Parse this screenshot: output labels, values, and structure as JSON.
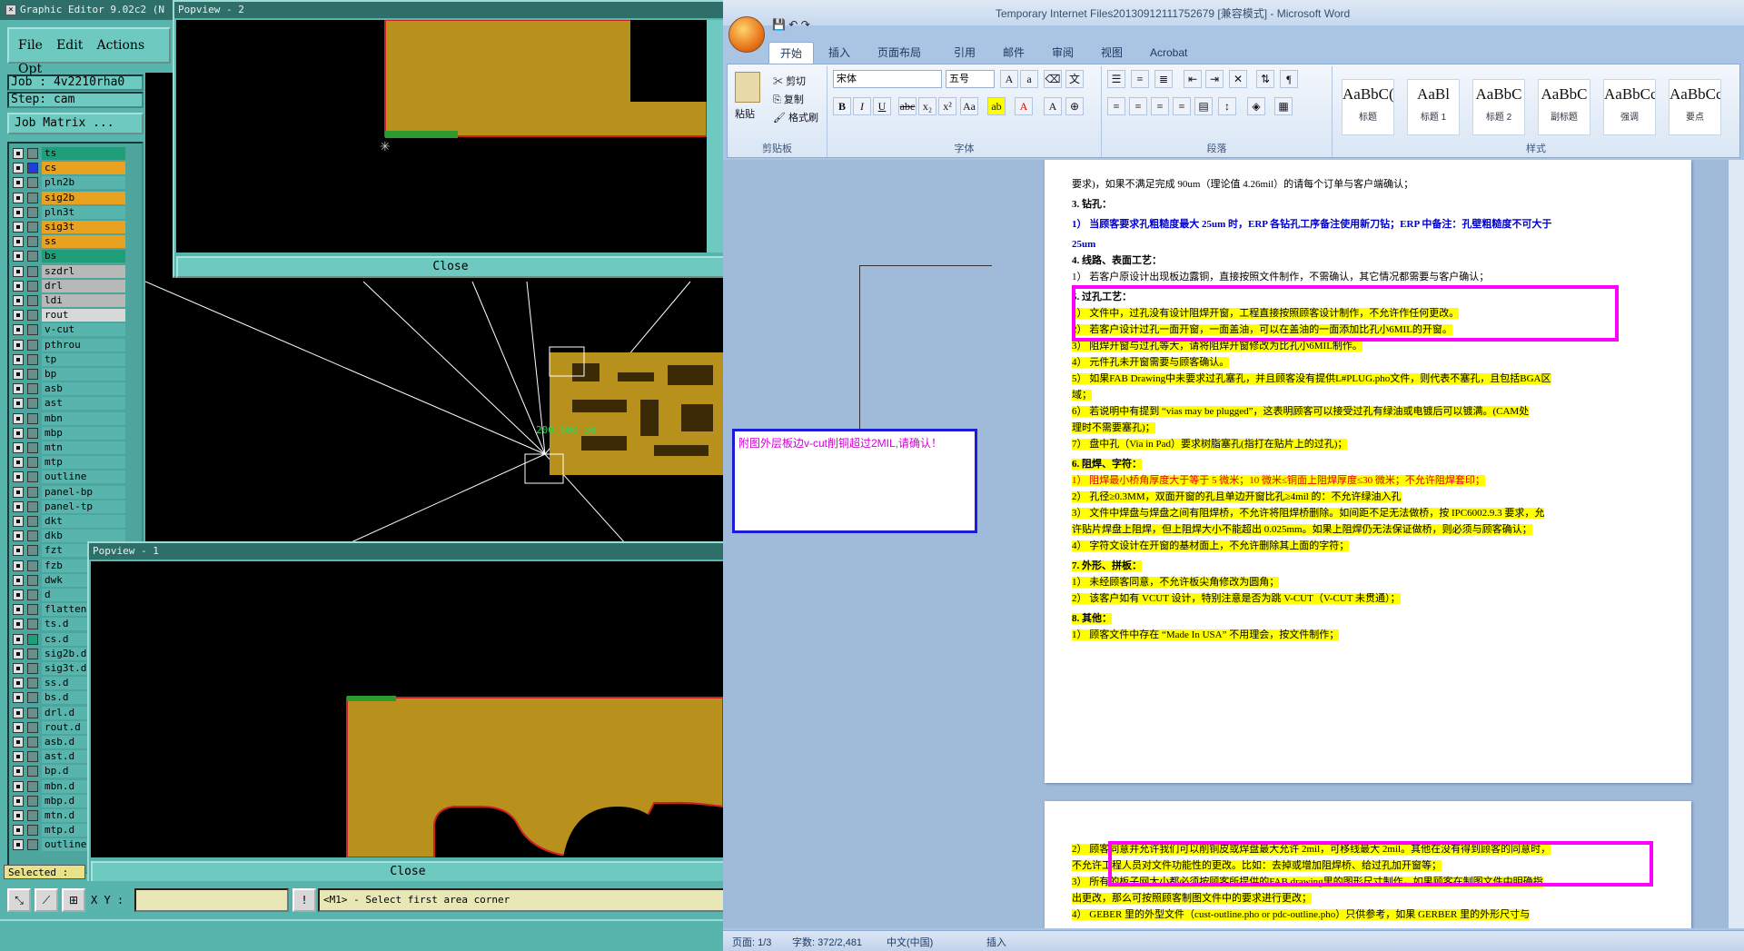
{
  "editor": {
    "title": "Graphic Editor 9.02c2 (N",
    "menu": [
      "File",
      "Edit",
      "Actions",
      "Opt"
    ],
    "job": "Job : 4v2210rha0",
    "step": "Step: cam",
    "job_matrix": "Job Matrix ...",
    "layers": [
      {
        "name": "ts",
        "color": "#1e9f7a"
      },
      {
        "name": "cs",
        "color": "#e9a21f",
        "swatch": "#1f3fd6"
      },
      {
        "name": "pln2b",
        "color": "#57b5ad"
      },
      {
        "name": "sig2b",
        "color": "#e9a21f"
      },
      {
        "name": "pln3t",
        "color": "#57b5ad"
      },
      {
        "name": "sig3t",
        "color": "#e9a21f"
      },
      {
        "name": "ss",
        "color": "#e9a21f"
      },
      {
        "name": "bs",
        "color": "#1e9f7a"
      },
      {
        "name": "szdrl",
        "color": "#b8b8b8"
      },
      {
        "name": "drl",
        "color": "#b8b8b8"
      },
      {
        "name": "ldi",
        "color": "#b8b8b8"
      },
      {
        "name": "rout",
        "color": "#d8d8d8"
      },
      {
        "name": "v-cut",
        "color": "#57b5ad"
      },
      {
        "name": "pthrou",
        "color": "#57b5ad"
      },
      {
        "name": "tp",
        "color": "#57b5ad"
      },
      {
        "name": "bp",
        "color": "#57b5ad"
      },
      {
        "name": "asb",
        "color": "#57b5ad"
      },
      {
        "name": "ast",
        "color": "#57b5ad"
      },
      {
        "name": "mbn",
        "color": "#57b5ad"
      },
      {
        "name": "mbp",
        "color": "#57b5ad"
      },
      {
        "name": "mtn",
        "color": "#57b5ad"
      },
      {
        "name": "mtp",
        "color": "#57b5ad"
      },
      {
        "name": "outline",
        "color": "#57b5ad"
      },
      {
        "name": "panel-bp",
        "color": "#57b5ad"
      },
      {
        "name": "panel-tp",
        "color": "#57b5ad"
      },
      {
        "name": "dkt",
        "color": "#57b5ad"
      },
      {
        "name": "dkb",
        "color": "#57b5ad"
      },
      {
        "name": "fzt",
        "color": "#57b5ad"
      },
      {
        "name": "fzb",
        "color": "#57b5ad"
      },
      {
        "name": "dwk",
        "color": "#57b5ad"
      },
      {
        "name": "d",
        "color": "#57b5ad"
      },
      {
        "name": "flatten",
        "color": "#57b5ad"
      },
      {
        "name": "ts.d",
        "color": "#57b5ad"
      },
      {
        "name": "cs.d",
        "color": "#57b5ad",
        "swatch": "#1e9f7a"
      },
      {
        "name": "sig2b.d",
        "color": "#57b5ad"
      },
      {
        "name": "sig3t.d",
        "color": "#57b5ad"
      },
      {
        "name": "ss.d",
        "color": "#57b5ad"
      },
      {
        "name": "bs.d",
        "color": "#57b5ad"
      },
      {
        "name": "drl.d",
        "color": "#57b5ad"
      },
      {
        "name": "rout.d",
        "color": "#57b5ad"
      },
      {
        "name": "asb.d",
        "color": "#57b5ad"
      },
      {
        "name": "ast.d",
        "color": "#57b5ad"
      },
      {
        "name": "bp.d",
        "color": "#57b5ad"
      },
      {
        "name": "mbn.d",
        "color": "#57b5ad"
      },
      {
        "name": "mbp.d",
        "color": "#57b5ad"
      },
      {
        "name": "mtn.d",
        "color": "#57b5ad"
      },
      {
        "name": "mtp.d",
        "color": "#57b5ad"
      },
      {
        "name": "outline",
        "color": "#57b5ad"
      }
    ],
    "selected": "Selected :",
    "coord_text": "200.000 30",
    "xy_label": "X Y :",
    "prompt": "<M1> - Select first area corner",
    "popview2_title": "Popview - 2",
    "popview1_title": "Popview - 1",
    "close_label": "Close"
  },
  "word": {
    "title": "Temporary Internet Files20130912111752679 [兼容模式] - Microsoft Word",
    "tabs": [
      "开始",
      "插入",
      "页面布局",
      "引用",
      "邮件",
      "审阅",
      "视图",
      "Acrobat"
    ],
    "clipboard": {
      "paste": "粘贴",
      "cut": "剪切",
      "copy": "复制",
      "painter": "格式刷",
      "label": "剪贴板"
    },
    "font": {
      "name": "宋体",
      "size": "五号",
      "label": "字体"
    },
    "paragraph_label": "段落",
    "styles_label": "样式",
    "styles": [
      {
        "sample": "AaBbC(",
        "name": "标题"
      },
      {
        "sample": "AaBl",
        "name": "标题 1"
      },
      {
        "sample": "AaBbC",
        "name": "标题 2"
      },
      {
        "sample": "AaBbC",
        "name": "副标题"
      },
      {
        "sample": "AaBbCcD",
        "name": "强调"
      },
      {
        "sample": "AaBbCcD",
        "name": "要点"
      }
    ],
    "comment": "附图外层板边v-cut削铜超过2MIL,请确认！",
    "page1_lines": [
      "要求)，如果不满足完成 90um（理论值 4.26mil）的请每个订单与客户端确认；",
      "3.  钻孔：",
      "1） 当顾客要求孔粗糙度最大 25um 时，ERP 各钻孔工序备注使用新刀钻；ERP 中备注：孔壁粗糙度不可大于",
      "25um",
      "4.  线路、表面工艺：",
      "1） 若客户原设计出现板边露铜，直接按照文件制作，不需确认，其它情况都需要与客户确认；",
      "5.  过孔工艺：",
      "1） 文件中，过孔没有设计阻焊开窗，工程直接按照顾客设计制作，不允许作任何更改。",
      "2） 若客户设计过孔一面开窗，一面盖油，可以在盖油的一面添加比孔小6MIL的开窗。",
      "3） 阻焊开窗与过孔等大，请将阻焊开窗修改为比孔小6MIL制作。",
      "4） 元件孔未开窗需要与顾客确认。",
      "5） 如果FAB Drawing中未要求过孔塞孔，并且顾客没有提供L#PLUG.pho文件，则代表不塞孔，且包括BGA区",
      "域；",
      "6） 若说明中有提到 “vias may be plugged”，这表明顾客可以接受过孔有绿油或电镀后可以镀满。(CAM处",
      "理时不需要塞孔)；",
      "7） 盘中孔（Via in Pad）要求树脂塞孔(指打在贴片上的过孔)；",
      "6.  阻焊、字符：",
      "1） 阻焊最小桥角厚度大于等于 5 微米；10 微米≤铜面上阻焊厚度≤30 微米；不允许阻焊套印；",
      "2） 孔径≥0.3MM，双面开窗的孔且单边开窗比孔≥4mil 的：不允许绿油入孔",
      "3） 文件中焊盘与焊盘之间有阻焊桥，不允许将阻焊桥删除。如间距不足无法做桥，按 IPC6002.9.3 要求，允",
      "许贴片焊盘上阻焊，但上阻焊大小不能超出 0.025mm。如果上阻焊仍无法保证做桥，则必须与顾客确认；",
      "4） 字符文设计在开窗的基材面上，不允许删除其上面的字符；",
      "7.  外形、拼板：",
      "1） 未经顾客同意，不允许板尖角修改为圆角；",
      "2） 该客户如有 VCUT 设计，特别注意是否为跳 V-CUT（V-CUT 未贯通）；",
      "8.  其他：",
      "1） 顾客文件中存在 “Made In USA” 不用理会，按文件制作；"
    ],
    "page2_lines": [
      "2） 顾客同意并允许我们可以削铜皮或焊盘最大允许 2mil，可移线最大 2mil。其他在没有得到顾客的同意时，",
      "不允许工程人员对文件功能性的更改。比如：去掉或增加阻焊桥、给过孔加开窗等；",
      "3） 所有的板子网大小都必须按顾客所提供的FAB drawing里的图形尺寸制作，如果顾客在制图文件中明确指",
      "出更改，那么可按照顾客制图文件中的要求进行更改；",
      "4） GEBER 里的外型文件（cust-outline.pho or pdc-outline.pho）只供参考，如果 GERBER 里的外形尺寸与"
    ],
    "status": {
      "page": "页面: 1/3",
      "words": "字数: 372/2,481",
      "lang": "中文(中国)",
      "mode": "插入"
    }
  }
}
